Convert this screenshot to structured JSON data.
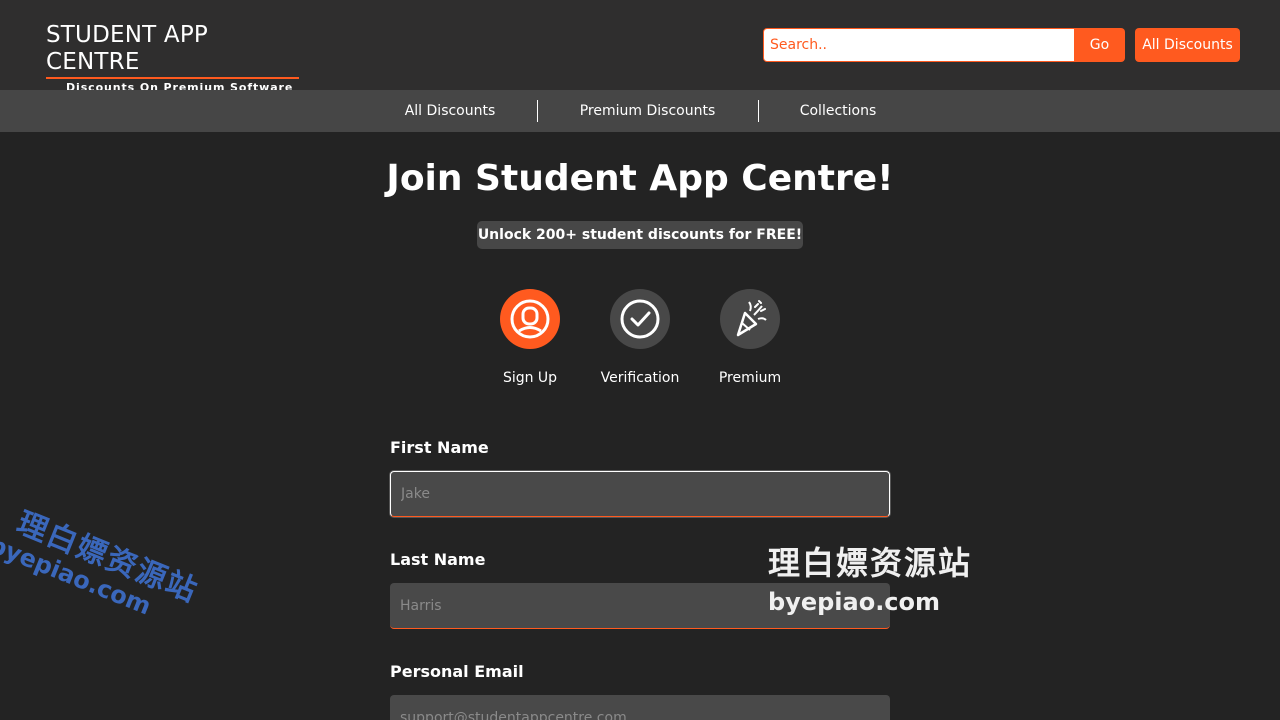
{
  "header": {
    "logo_title": "STUDENT APP CENTRE",
    "logo_subtitle": "Discounts On Premium Software",
    "search_placeholder": "Search..",
    "go_label": "Go",
    "all_discounts_label": "All Discounts"
  },
  "nav": {
    "items": [
      {
        "label": "All Discounts"
      },
      {
        "label": "Premium Discounts"
      },
      {
        "label": "Collections"
      }
    ]
  },
  "main": {
    "title": "Join Student App Centre!",
    "tagline": "Unlock 200+ student discounts for FREE!",
    "steps": [
      {
        "label": "Sign Up",
        "icon": "user-icon",
        "active": true
      },
      {
        "label": "Verification",
        "icon": "check-icon",
        "active": false
      },
      {
        "label": "Premium",
        "icon": "party-popper-icon",
        "active": false
      }
    ],
    "form": {
      "first_name_label": "First Name",
      "first_name_placeholder": "Jake",
      "last_name_label": "Last Name",
      "last_name_placeholder": "Harris",
      "email_label": "Personal Email",
      "email_placeholder": "support@studentappcentre.com"
    }
  },
  "watermark": {
    "cn": "理白嫖资源站",
    "en": "byepiao.com"
  },
  "colors": {
    "accent": "#ff5a1f",
    "background": "#232323",
    "header": "#2f2e2e",
    "nav": "#464646"
  }
}
